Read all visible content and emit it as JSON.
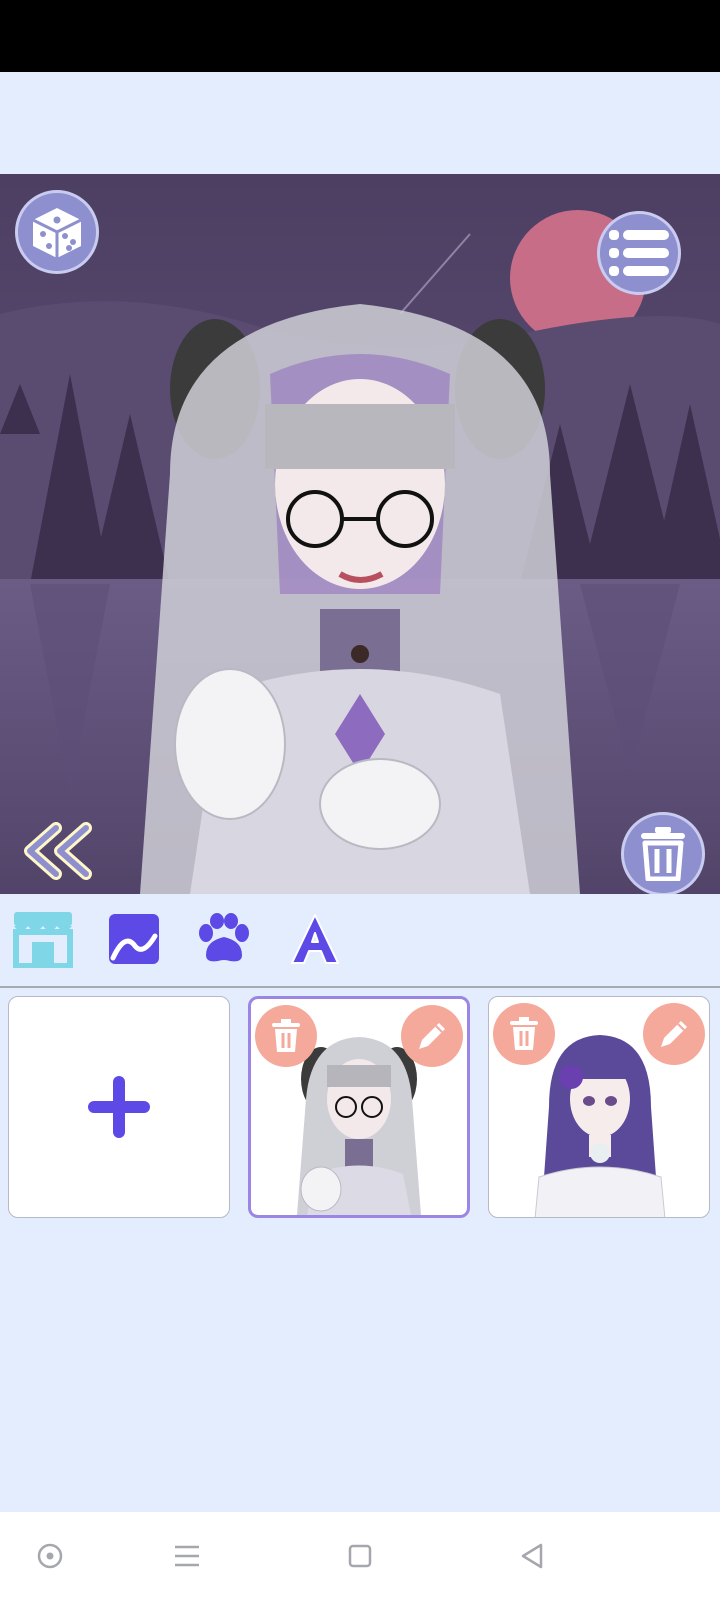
{
  "app": {
    "accent_color": "#8e8fce",
    "panel_color": "#e3edfd",
    "selection_color": "#9b86e6"
  },
  "canvas_controls": {
    "randomize_icon": "dice-icon",
    "menu_icon": "list-icon",
    "collapse_icon": "double-chevron-left-icon",
    "delete_icon": "trash-icon"
  },
  "toolbar": {
    "items": [
      {
        "icon": "shop-icon"
      },
      {
        "icon": "background-image-icon"
      },
      {
        "icon": "paw-icon"
      },
      {
        "icon": "text-icon",
        "glyph": "A"
      }
    ]
  },
  "saved_characters": {
    "add_icon": "plus-icon",
    "slots": [
      {
        "selected": true,
        "delete_icon": "trash-icon",
        "edit_icon": "pencil-icon"
      },
      {
        "selected": false,
        "delete_icon": "trash-icon",
        "edit_icon": "pencil-icon"
      }
    ]
  },
  "nav_bar": {
    "items": [
      "home-icon",
      "menu-icon",
      "overview-icon",
      "back-icon"
    ]
  }
}
